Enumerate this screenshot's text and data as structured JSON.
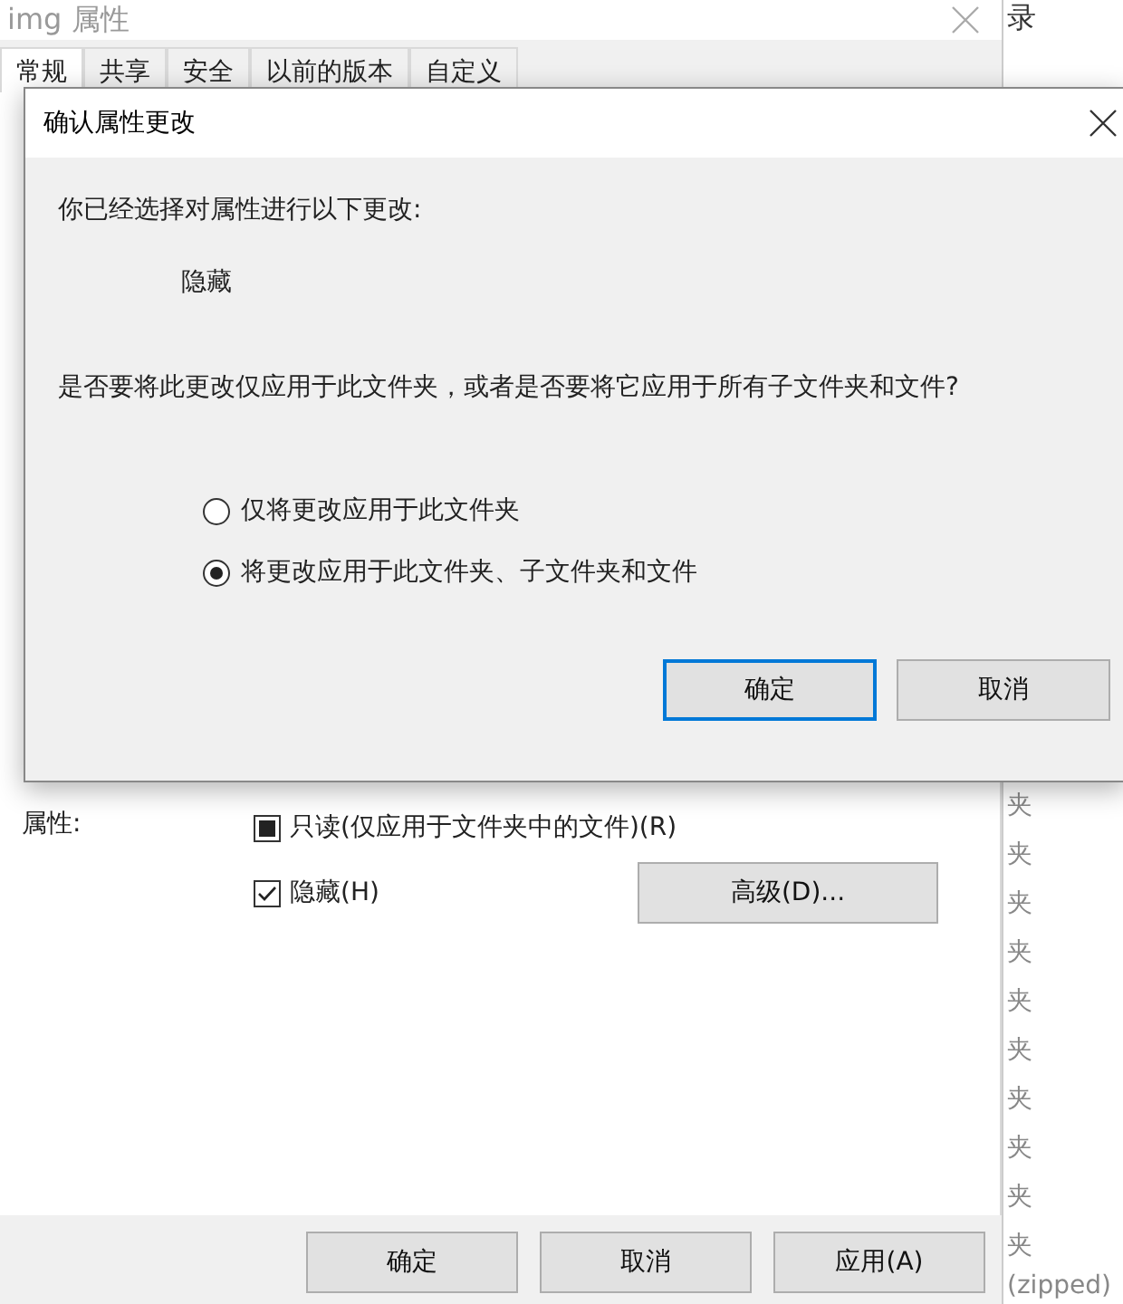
{
  "properties_window": {
    "title": "img 属性",
    "tabs": [
      {
        "label": "常规",
        "selected": true
      },
      {
        "label": "共享",
        "selected": false
      },
      {
        "label": "安全",
        "selected": false
      },
      {
        "label": "以前的版本",
        "selected": false
      },
      {
        "label": "自定义",
        "selected": false
      }
    ],
    "attributes_label": "属性:",
    "attributes": [
      {
        "label": "只读(仅应用于文件夹中的文件)(R)",
        "checked": false,
        "mixed": true
      },
      {
        "label": "隐藏(H)",
        "checked": true,
        "mixed": false
      }
    ],
    "advanced_button": "高级(D)...",
    "buttons": [
      "确定",
      "取消",
      "应用(A)"
    ]
  },
  "explorer_background": {
    "header": "录",
    "items": [
      "夹",
      "夹",
      "夹",
      "夹",
      "夹",
      "夹",
      "夹",
      "夹",
      "夹",
      "夹"
    ],
    "footer": "(zipped)"
  },
  "dialog": {
    "title": "确认属性更改",
    "intro": "你已经选择对属性进行以下更改:",
    "change": "隐藏",
    "question": "是否要将此更改仅应用于此文件夹，或者是否要将它应用于所有子文件夹和文件?",
    "options": [
      {
        "label": "仅将更改应用于此文件夹",
        "selected": false
      },
      {
        "label": "将更改应用于此文件夹、子文件夹和文件",
        "selected": true
      }
    ],
    "buttons": [
      {
        "label": "确定",
        "focused": true
      },
      {
        "label": "取消",
        "focused": false
      }
    ]
  }
}
